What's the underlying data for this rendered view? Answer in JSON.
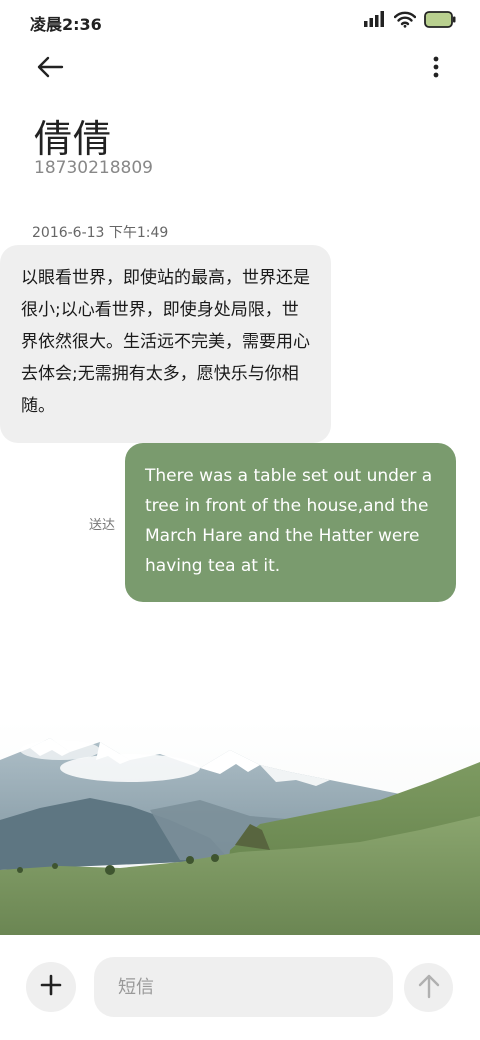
{
  "status_bar": {
    "time": "凌晨2:36",
    "icons": [
      "signal-icon",
      "wifi-icon",
      "battery-icon"
    ],
    "battery_color": "#b9d08f"
  },
  "header": {
    "back_icon": "arrow-left-icon",
    "more_icon": "more-vertical-icon"
  },
  "contact": {
    "name": "倩倩",
    "number": "18730218809"
  },
  "conversation": {
    "timestamp": "2016-6-13 下午1:49",
    "messages": [
      {
        "direction": "incoming",
        "text": "以眼看世界，即使站的最高，世界还是很小;以心看世界，即使身处局限，世界依然很大。生活远不完美，需要用心去体会;无需拥有太多，愿快乐与你相随。"
      },
      {
        "direction": "outgoing",
        "status": "送达",
        "text": "There was a table set out under a tree in front of the house,and the March Hare and the Hatter were having tea at it."
      }
    ]
  },
  "composer": {
    "attach_icon": "plus-icon",
    "placeholder": "短信",
    "value": "",
    "send_icon": "arrow-up-icon"
  },
  "colors": {
    "incoming_bubble": "#efefef",
    "outgoing_bubble": "#7a9b6e"
  }
}
